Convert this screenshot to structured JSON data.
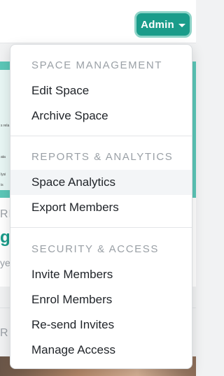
{
  "header": {
    "admin_label": "Admin"
  },
  "background": {
    "tiny_texts": [
      "s rela",
      "ata",
      "lysi",
      "is"
    ],
    "frag_label": "RE",
    "frag_teal": "g",
    "frag_sub": "ye",
    "frag_label2": "RI"
  },
  "dropdown": {
    "sections": [
      {
        "title": "SPACE MANAGEMENT",
        "items": [
          "Edit Space",
          "Archive Space"
        ]
      },
      {
        "title": "REPORTS & ANALYTICS",
        "items": [
          "Space Analytics",
          "Export Members"
        ]
      },
      {
        "title": "SECURITY & ACCESS",
        "items": [
          "Invite Members",
          "Enrol Members",
          "Re-send Invites",
          "Manage Access"
        ]
      }
    ],
    "active_item": "Space Analytics"
  },
  "colors": {
    "accent": "#1a9c8a",
    "accent_ring": "#8fd4c8",
    "hero": "#5cc7b8",
    "section_text": "#9aa0a6",
    "item_text": "#1f2328",
    "active_bg": "#f3f5f7"
  },
  "icons": {
    "admin_caret": "caret-down-icon"
  }
}
